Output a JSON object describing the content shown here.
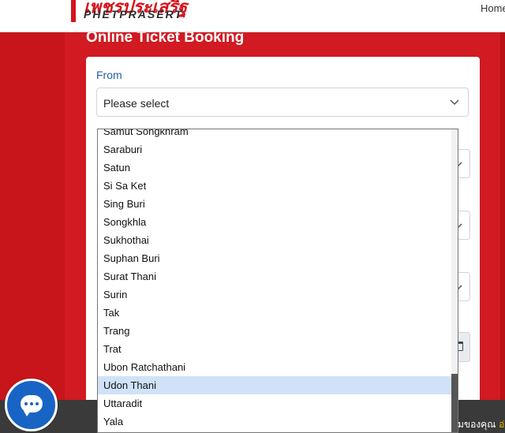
{
  "header": {
    "logo_thai": "เพชรประเสริฐ",
    "logo_en": "PHETPRASERT",
    "nav_home": "Home"
  },
  "page": {
    "title": "Online Ticket Booking"
  },
  "form": {
    "from_label": "From",
    "from_value": "Please select"
  },
  "dropdown": {
    "options": [
      "Samut Songkhram",
      "Saraburi",
      "Satun",
      "Si Sa Ket",
      "Sing Buri",
      "Songkhla",
      "Sukhothai",
      "Suphan Buri",
      "Surat Thani",
      "Surin",
      "Tak",
      "Trang",
      "Trat",
      "Ubon Ratchathani",
      "Udon Thani",
      "Uttaradit",
      "Yala"
    ],
    "selected": "Udon Thani"
  },
  "footer": {
    "consent_text": "มของคุณ",
    "consent_link": "อ่"
  },
  "colors": {
    "brand_red": "#d11a21",
    "selection": "#cfe2f8",
    "chat_blue": "#1864c4"
  }
}
